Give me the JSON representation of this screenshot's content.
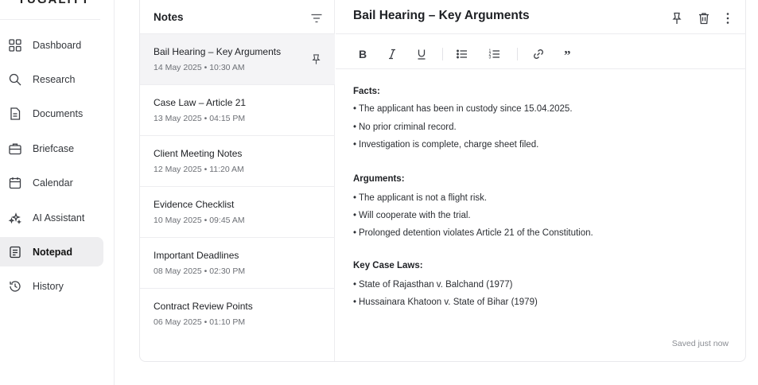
{
  "brand": {
    "name": "YUGALITY"
  },
  "sidebar": {
    "items": [
      {
        "label": "Dashboard",
        "icon": "dashboard-icon"
      },
      {
        "label": "Research",
        "icon": "search-icon"
      },
      {
        "label": "Documents",
        "icon": "document-icon"
      },
      {
        "label": "Briefcase",
        "icon": "briefcase-icon"
      },
      {
        "label": "Calendar",
        "icon": "calendar-icon"
      },
      {
        "label": "AI Assistant",
        "icon": "sparkles-icon"
      },
      {
        "label": "Notepad",
        "icon": "notepad-icon",
        "active": true
      },
      {
        "label": "History",
        "icon": "history-icon"
      }
    ]
  },
  "notes": {
    "title": "Notes",
    "items": [
      {
        "title": "Bail Hearing – Key Arguments",
        "date": "14 May 2025  •  10:30 AM",
        "pinned": true,
        "active": true
      },
      {
        "title": "Case Law – Article 21",
        "date": "13 May 2025  •  04:15 PM"
      },
      {
        "title": "Client Meeting Notes",
        "date": "12 May 2025  •  11:20 AM"
      },
      {
        "title": "Evidence Checklist",
        "date": "10 May 2025  •  09:45 AM"
      },
      {
        "title": "Important Deadlines",
        "date": "08 May 2025  •  02:30 PM"
      },
      {
        "title": "Contract Review Points",
        "date": "06 May 2025  •  01:10 PM"
      }
    ]
  },
  "editor": {
    "title": "Bail Hearing – Key Arguments",
    "toolbar": [
      "bold",
      "italic",
      "underline",
      "bullet-list",
      "numbered-list",
      "link",
      "quote"
    ],
    "sections": [
      {
        "heading": "Facts:",
        "bullets": [
          "The applicant has been in custody since 15.04.2025.",
          "No prior criminal record.",
          "Investigation is complete, charge sheet filed."
        ]
      },
      {
        "heading": "Arguments:",
        "bullets": [
          "The applicant is not a flight risk.",
          "Will cooperate with the trial.",
          "Prolonged detention violates Article 21 of the Constitution."
        ]
      },
      {
        "heading": "Key Case Laws:",
        "bullets": [
          "State of Rajasthan v. Balchand (1977)",
          "Hussainara Khatoon v. State of Bihar (1979)"
        ]
      }
    ],
    "status": "Saved just now"
  },
  "colors": {
    "active_bg": "#eeeef0",
    "border": "#ececef",
    "muted": "#6d7076"
  }
}
